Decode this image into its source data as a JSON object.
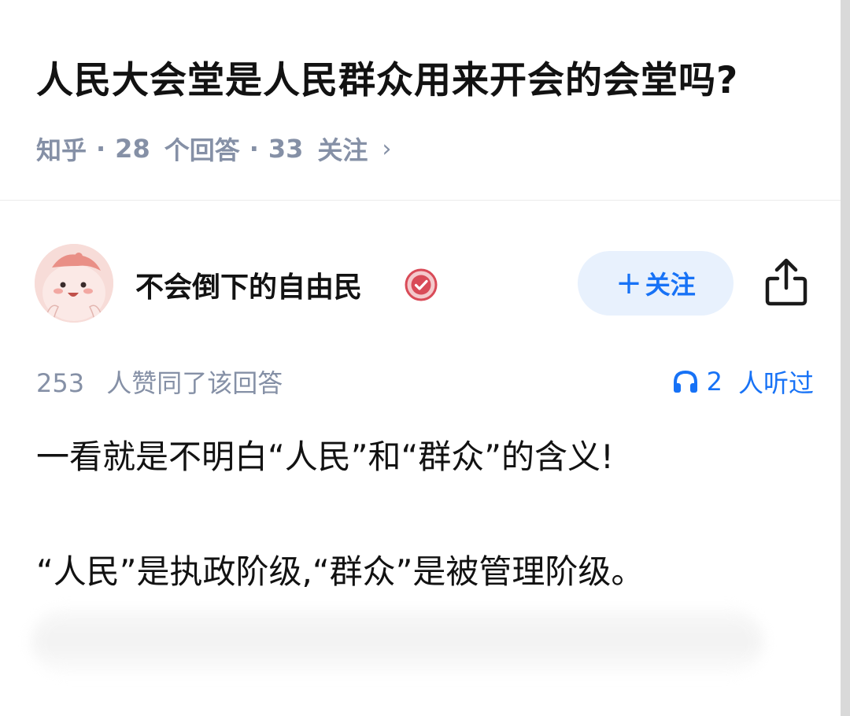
{
  "question": {
    "title": "人民大会堂是人民群众用来开会的会堂吗?",
    "source": "知乎",
    "answers_count": "28",
    "answers_label": "个回答",
    "followers_count": "33",
    "followers_label": "关注",
    "chevron": "›"
  },
  "author": {
    "name": "不会倒下的自由民",
    "follow_label": "关注",
    "follow_plus": "+"
  },
  "stats": {
    "upvotes": "253",
    "upvotes_label": "人赞同了该回答",
    "listeners": "2",
    "listeners_label": "人听过"
  },
  "answer": {
    "paragraphs": [
      "一看就是不明白“人民”和“群众”的含义!",
      "“人民”是执政阶级,“群众”是被管理阶级。"
    ]
  },
  "colors": {
    "accent": "#1772f6",
    "follow_bg": "#e8f1fd",
    "meta_gray": "#8590a6",
    "text": "#121212"
  },
  "icons": {
    "verify": "verified-badge-icon",
    "share": "share-icon",
    "headphones": "headphones-icon",
    "chevron": "chevron-right-icon"
  }
}
